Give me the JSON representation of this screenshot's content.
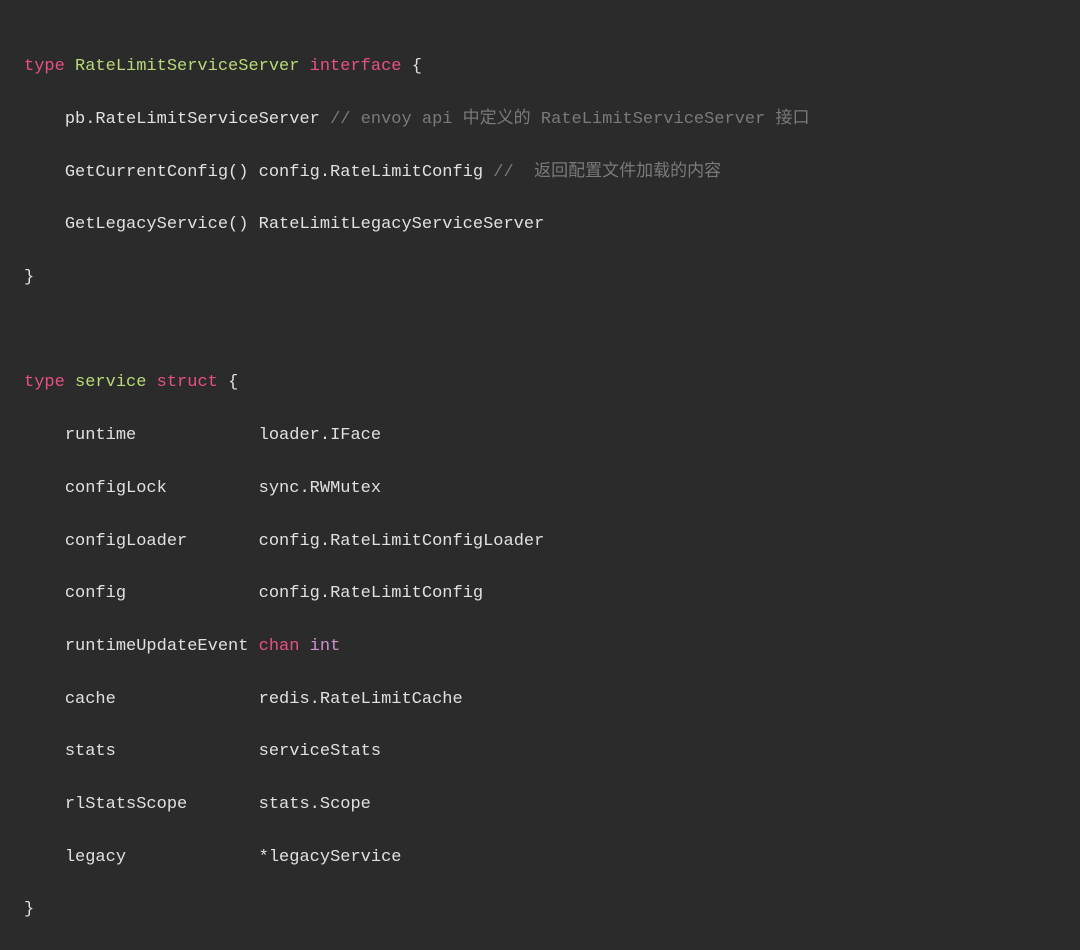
{
  "code": {
    "line1": {
      "type": "type",
      "name": "RateLimitServiceServer",
      "kind": "interface",
      "open": "{"
    },
    "line2": {
      "indent": "    ",
      "content": "pb.RateLimitServiceServer ",
      "comment": "// envoy api 中定义的 RateLimitServiceServer 接口"
    },
    "line3": {
      "indent": "    ",
      "content": "GetCurrentConfig() config.RateLimitConfig ",
      "comment": "//  返回配置文件加载的内容"
    },
    "line4": {
      "indent": "    ",
      "content": "GetLegacyService() RateLimitLegacyServiceServer"
    },
    "line5": {
      "close": "}"
    },
    "line7": {
      "type": "type",
      "name": "service",
      "kind": "struct",
      "open": "{"
    },
    "line8": {
      "indent": "    ",
      "field": "runtime            ",
      "ftype": "loader.IFace"
    },
    "line9": {
      "indent": "    ",
      "field": "configLock         ",
      "ftype": "sync.RWMutex"
    },
    "line10": {
      "indent": "    ",
      "field": "configLoader       ",
      "ftype": "config.RateLimitConfigLoader"
    },
    "line11": {
      "indent": "    ",
      "field": "config             ",
      "ftype": "config.RateLimitConfig"
    },
    "line12": {
      "indent": "    ",
      "field": "runtimeUpdateEvent ",
      "chan": "chan",
      "int": "int"
    },
    "line13": {
      "indent": "    ",
      "field": "cache              ",
      "ftype": "redis.RateLimitCache"
    },
    "line14": {
      "indent": "    ",
      "field": "stats              ",
      "ftype": "serviceStats"
    },
    "line15": {
      "indent": "    ",
      "field": "rlStatsScope       ",
      "ftype": "stats.Scope"
    },
    "line16": {
      "indent": "    ",
      "field": "legacy             ",
      "ftype": "*legacyService"
    },
    "line17": {
      "close": "}"
    }
  }
}
